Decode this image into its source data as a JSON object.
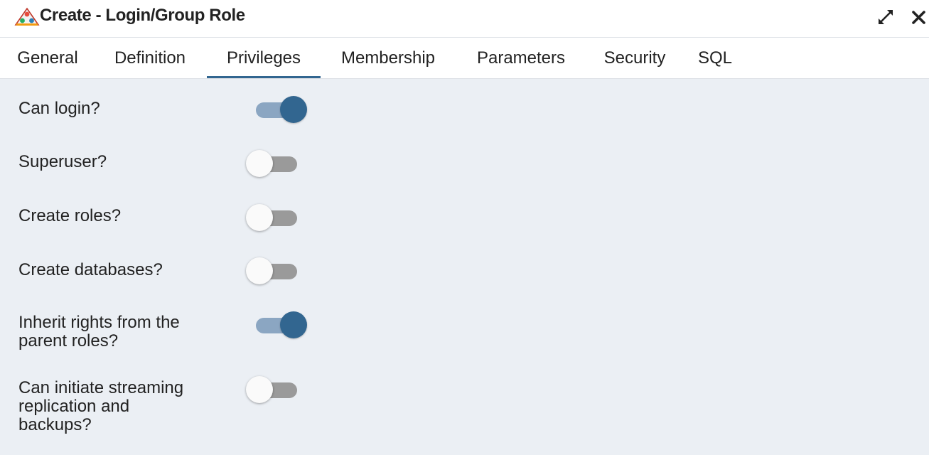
{
  "window": {
    "title": "Create - Login/Group Role",
    "icon": "role-triangle-icon",
    "maximize_icon": "expand-arrows-icon",
    "close_icon": "close-x-icon"
  },
  "tabs": [
    {
      "label": "General",
      "active": false
    },
    {
      "label": "Definition",
      "active": false
    },
    {
      "label": "Privileges",
      "active": true
    },
    {
      "label": "Membership",
      "active": false
    },
    {
      "label": "Parameters",
      "active": false
    },
    {
      "label": "Security",
      "active": false
    },
    {
      "label": "SQL",
      "active": false
    }
  ],
  "privileges": [
    {
      "label": "Can login?",
      "enabled": true
    },
    {
      "label": "Superuser?",
      "enabled": false
    },
    {
      "label": "Create roles?",
      "enabled": false
    },
    {
      "label": "Create databases?",
      "enabled": false
    },
    {
      "label": "Inherit rights from the parent roles?",
      "enabled": true
    },
    {
      "label": "Can initiate streaming replication and backups?",
      "enabled": false
    }
  ],
  "colors": {
    "accent": "#326690",
    "switch_on_track": "#8ba6c2",
    "switch_off_track": "#9a9a9a",
    "panel_bg": "#ebeff4"
  }
}
